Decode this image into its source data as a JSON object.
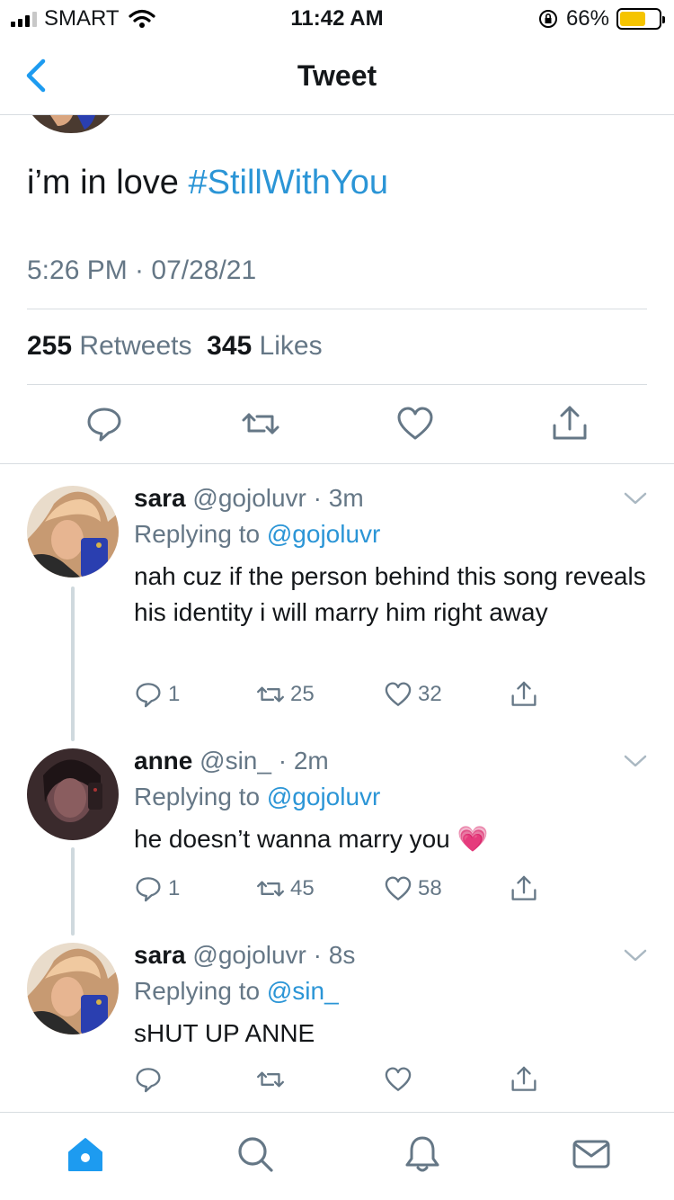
{
  "status_bar": {
    "carrier": "SMART",
    "time": "11:42 AM",
    "battery_pct": "66%",
    "battery_level": 0.66,
    "battery_color": "#f5c400"
  },
  "nav": {
    "title": "Tweet",
    "back_icon": "chevron-left-icon"
  },
  "tweet": {
    "text": "i’m in love ",
    "hashtag": "#StillWithYou",
    "timestamp": "5:26 PM · 07/28/21",
    "retweets_count": "255",
    "retweets_label": "Retweets",
    "likes_count": "345",
    "likes_label": "Likes",
    "actions": [
      "reply-icon",
      "retweet-icon",
      "like-icon",
      "share-icon"
    ]
  },
  "replies": [
    {
      "name": "sara",
      "handle": "@gojoluvr",
      "time": " · 3m",
      "replying_label": "Replying to ",
      "replying_to": "@gojoluvr",
      "text": "nah cuz if the person behind this song reveals his identity i will marry him right away",
      "reply_count": "1",
      "retweet_count": "25",
      "like_count": "32"
    },
    {
      "name": "anne",
      "handle": "@sin_",
      "time": " · 2m",
      "replying_label": "Replying to ",
      "replying_to": "@gojoluvr",
      "text": "he doesn’t wanna marry you 💗",
      "reply_count": "1",
      "retweet_count": "45",
      "like_count": "58"
    },
    {
      "name": "sara",
      "handle": "@gojoluvr",
      "time": " · 8s",
      "replying_label": "Replying to ",
      "replying_to": "@sin_",
      "text": "sHUT UP ANNE",
      "reply_count": "",
      "retweet_count": "",
      "like_count": ""
    }
  ],
  "tabbar": {
    "items": [
      "home-icon",
      "search-icon",
      "notifications-icon",
      "messages-icon"
    ],
    "active_color": "#1d9bf0"
  },
  "colors": {
    "accent": "#2b95d6",
    "muted": "#657786",
    "text": "#14171a"
  }
}
